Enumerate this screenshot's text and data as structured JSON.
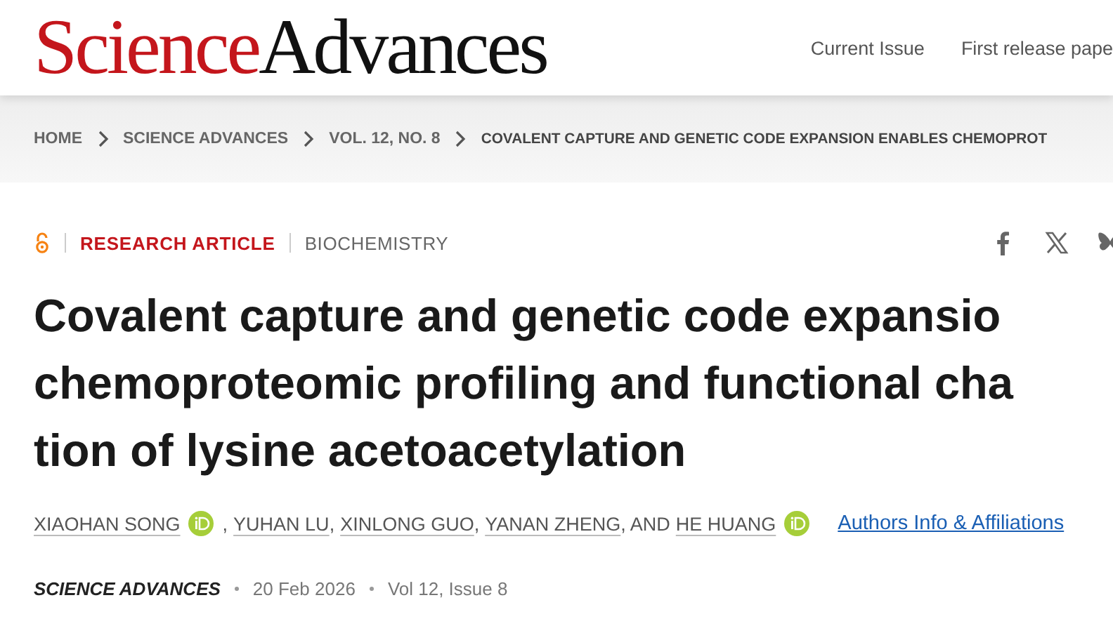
{
  "header": {
    "logo": {
      "part_1": "Science",
      "part_2": "Advances"
    },
    "nav": [
      "Current Issue",
      "First release pape"
    ]
  },
  "breadcrumb": [
    "HOME",
    "SCIENCE ADVANCES",
    "VOL. 12, NO. 8",
    "COVALENT CAPTURE AND GENETIC CODE EXPANSION ENABLES CHEMOPROT"
  ],
  "article": {
    "open_access": true,
    "type": "RESEARCH ARTICLE",
    "subject": "BIOCHEMISTRY",
    "title_lines": [
      "Covalent capture and genetic code expansio",
      "chemoproteomic profiling and functional cha",
      "tion of lysine acetoacetylation"
    ],
    "authors": [
      {
        "name": "XIAOHAN SONG",
        "orcid": true,
        "after": ","
      },
      {
        "name": "YUHAN LU",
        "orcid": false,
        "after": ","
      },
      {
        "name": "XINLONG GUO",
        "orcid": false,
        "after": ","
      },
      {
        "name": "YANAN ZHENG",
        "orcid": false,
        "after": ", AND"
      },
      {
        "name": "HE HUANG",
        "orcid": true
      }
    ],
    "affiliations_link": "Authors Info & Affiliations",
    "journal": "SCIENCE ADVANCES",
    "date": "20 Feb 2026",
    "issue": "Vol 12, Issue 8"
  }
}
